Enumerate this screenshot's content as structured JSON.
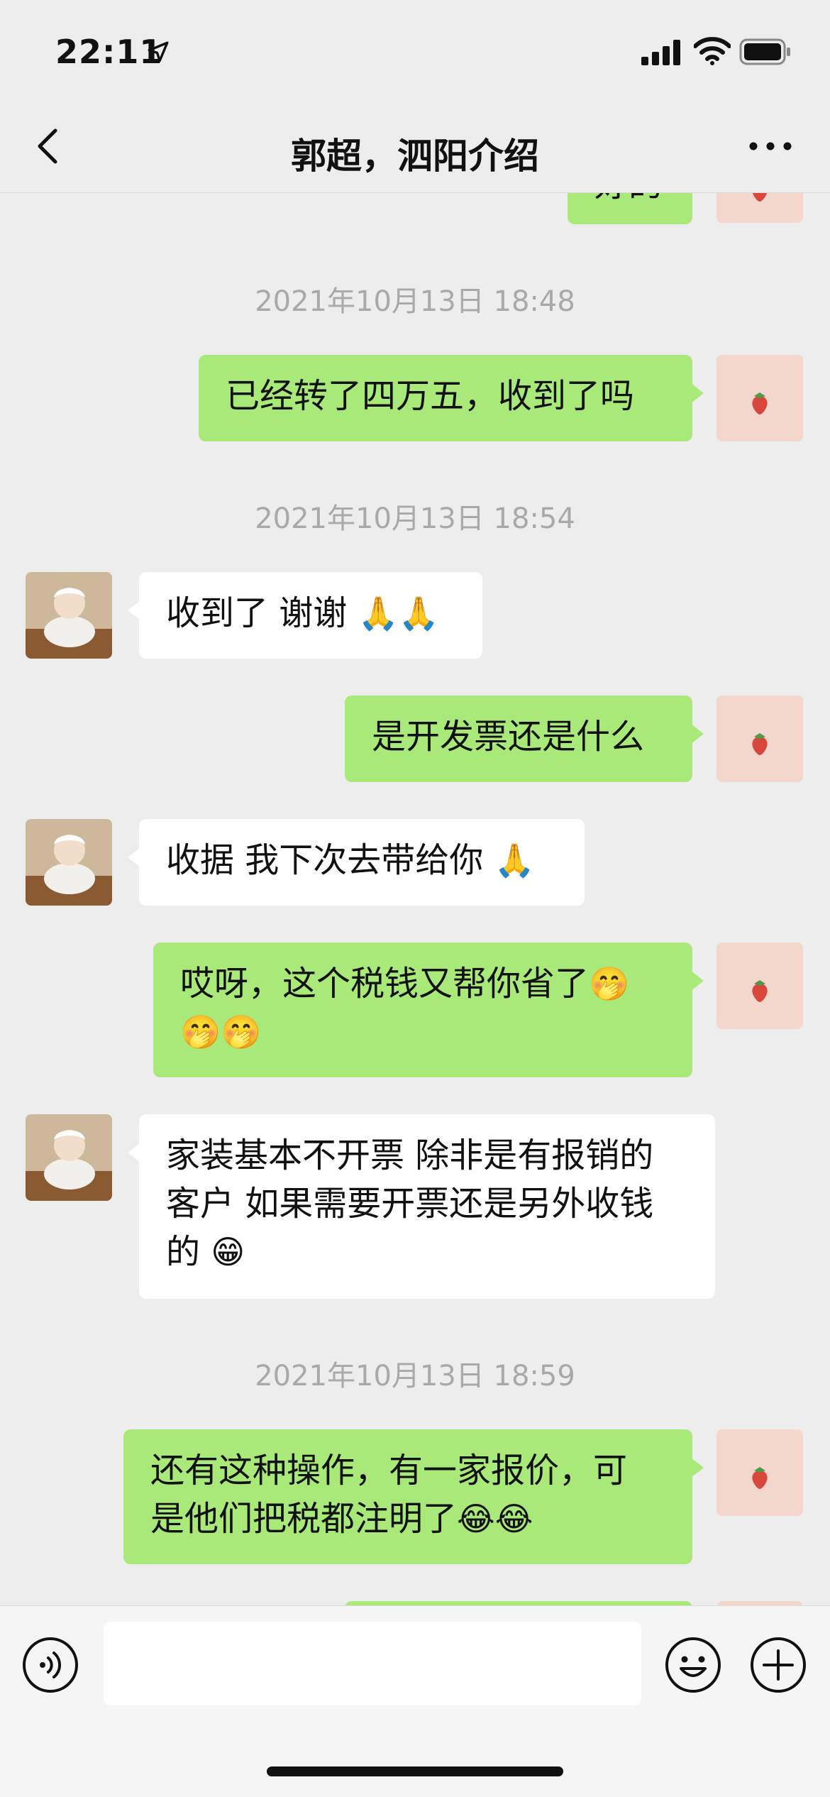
{
  "status_bar": {
    "time": "22:11",
    "icons": [
      "location-arrow-icon",
      "signal-icon",
      "wifi-icon",
      "battery-icon"
    ]
  },
  "nav": {
    "title": "郭超，泗阳介绍",
    "icons": [
      "back-icon",
      "more-icon"
    ]
  },
  "messages": {
    "top_partial": "好的",
    "ts1": "2021年10月13日 18:48",
    "m1": "已经转了四万五，收到了吗",
    "ts2": "2021年10月13日 18:54",
    "m2_text": "收到了 谢谢 ",
    "m2_emoji": "🙏🙏",
    "m3": "是开发票还是什么",
    "m4_text": "收据 我下次去带给你 ",
    "m4_emoji": "🙏",
    "m5_line1": "哎呀，这个税钱又帮你省了",
    "m5_emoji1": "🤭",
    "m5_emoji2": "🤭🤭",
    "m6_line1": "家装基本不开票 除非是有报销的",
    "m6_line2": "客户 如果需要开票还是另外收钱",
    "m6_line3": "的 ",
    "m6_emoji": "😁",
    "ts3": "2021年10月13日 18:59",
    "m7_line1": "还有这种操作，有一家报价，可",
    "m7_line2": "是他们把税都注明了",
    "m7_emoji": "😂😂"
  },
  "input_bar": {
    "message_value": "",
    "icons": [
      "voice-icon",
      "emoji-face-icon",
      "plus-icon"
    ]
  },
  "colors": {
    "background": "#ededed",
    "self_bubble": "#a8e97a",
    "other_bubble": "#ffffff",
    "timestamp_text": "#a9a9a9"
  }
}
